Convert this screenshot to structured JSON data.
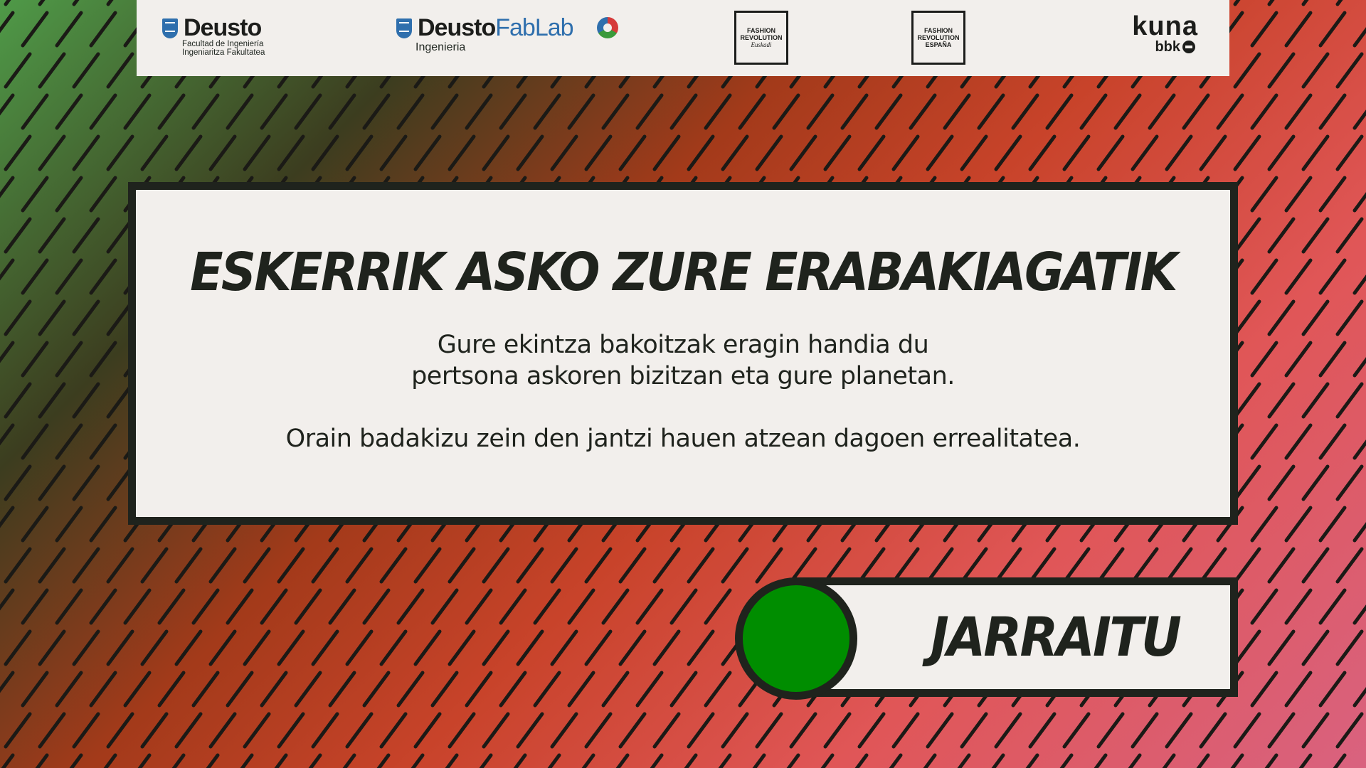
{
  "header": {
    "logos": {
      "deusto": {
        "name": "Deusto",
        "sub_line1": "Facultad de Ingeniería",
        "sub_line2": "Ingeniaritza Fakultatea"
      },
      "fablab": {
        "name_bold": "Deusto",
        "name_light": "FabLab",
        "sub": "Ingenieria"
      },
      "fashion_revolution_euskadi": {
        "line1": "FASHION",
        "line2": "REVOLUTION",
        "line3": "Euskadi"
      },
      "fashion_revolution_espana": {
        "line1": "FASHION",
        "line2": "REVOLUTION",
        "line3": "ESPAÑA"
      },
      "kuna": {
        "name": "kuna",
        "sub": "bbk"
      }
    }
  },
  "panel": {
    "title": "ESKERRIK ASKO ZURE ERABAKIAGATIK",
    "line1": "Gure ekintza bakoitzak eragin handia du",
    "line2": "pertsona askoren bizitzan eta gure planetan.",
    "line3": "Orain badakizu zein den jantzi hauen atzean dagoen errealitatea."
  },
  "continue_button": {
    "label": "JARRAITU",
    "indicator_color": "#008d00"
  },
  "colors": {
    "panel_bg": "#f2efec",
    "border": "#1f231d",
    "bg_green": "#4f9a48",
    "bg_red": "#c8432a",
    "bg_pink": "#d9627f"
  }
}
